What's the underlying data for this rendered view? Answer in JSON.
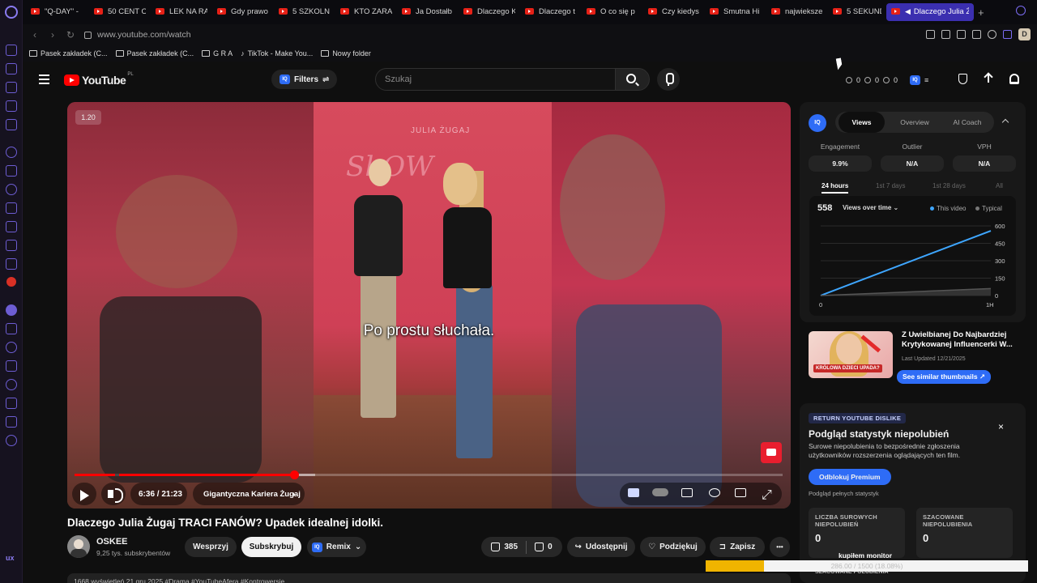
{
  "browser": {
    "tabs": [
      {
        "label": "\"Q-DAY\" - "
      },
      {
        "label": "50 CENT O"
      },
      {
        "label": "LEK NA RA"
      },
      {
        "label": "Gdy prawo"
      },
      {
        "label": "5 SZKOLN"
      },
      {
        "label": "KTO ZARA"
      },
      {
        "label": "Ja Dostałb"
      },
      {
        "label": "Dlaczego K"
      },
      {
        "label": "Dlaczego t"
      },
      {
        "label": "O co się p"
      },
      {
        "label": "Czy kiedys"
      },
      {
        "label": "Smutna Hi"
      },
      {
        "label": "najwieksze"
      },
      {
        "label": "5 SEKUND"
      },
      {
        "label": "Dlaczego Julia Ż"
      }
    ],
    "new_tab": "+",
    "url": "www.youtube.com/watch",
    "profile_initial": "D",
    "bookmarks": [
      {
        "label": "Pasek zakładek (C..."
      },
      {
        "label": "Pasek zakładek (C..."
      },
      {
        "label": "G R A"
      },
      {
        "label": "TikTok - Make You..."
      },
      {
        "label": "Nowy folder"
      }
    ]
  },
  "sidebar": {
    "bottom_label": "ux"
  },
  "header": {
    "logo": "YouTube",
    "region": "PL",
    "filters": "Filters",
    "iq_small": "IQ",
    "search_placeholder": "Szukaj",
    "stats": [
      "0",
      "0",
      "0"
    ]
  },
  "player": {
    "speed": "1.20",
    "subtitle": "Po prostu słuchała.",
    "wall_text": "JULIA ŻUGAJ",
    "wall_logo": "ShOW",
    "time": "6:36 / 21:23",
    "chapter": "Gigantyczna Kariera Żugaj",
    "chapter_arrow": "›",
    "progress": 0.31,
    "buffered": 0.34
  },
  "video": {
    "title": "Dlaczego Julia Żugaj TRACI FANÓW? Upadek idealnej idolki.",
    "channel": "OSKEE",
    "subscribers": "9,25 tys. subskrybentów",
    "buttons": {
      "support": "Wesprzyj",
      "subscribe": "Subskrybuj",
      "remix": "Remix",
      "likes": "385",
      "dislikes": "0",
      "share": "Udostępnij",
      "thanks": "Podziękuj",
      "save": "Zapisz",
      "more": "•••"
    },
    "description_peek": "1668 wyświetleń  21 gru 2025  #Drama #YouTubeAfera #Kontrowersje"
  },
  "vidiq": {
    "badge": "IQ",
    "tabs": [
      "Views",
      "Overview",
      "AI Coach"
    ],
    "active_tab": "Views",
    "metrics": [
      {
        "label": "Engagement",
        "value": "9.9%"
      },
      {
        "label": "Outlier",
        "value": "N/A"
      },
      {
        "label": "VPH",
        "value": "N/A"
      }
    ],
    "ranges": [
      "24 hours",
      "1st 7 days",
      "1st 28 days",
      "All"
    ],
    "active_range": "24 hours",
    "views": "558",
    "chart_selector": "Views over time ⌄",
    "legend_this": "This video",
    "legend_typical": "Typical",
    "colors": {
      "this_video": "#3ea6ff",
      "typical": "#555555"
    },
    "chart_data": {
      "type": "line",
      "x_ticks": [
        "0",
        "1H"
      ],
      "y_ticks": [
        "600",
        "450",
        "300",
        "150",
        "0"
      ],
      "ylim": [
        0,
        600
      ],
      "series": [
        {
          "name": "This video",
          "x": [
            0,
            1
          ],
          "values": [
            0,
            558
          ]
        },
        {
          "name": "Typical",
          "x": [
            0,
            1
          ],
          "values": [
            0,
            60
          ]
        }
      ]
    },
    "similar": {
      "title": "Z Uwielbianej Do Najbardziej Krytykowanej Influencerki W...",
      "date": "Last Updated 12/21/2025",
      "button": "See similar thumbnails ↗",
      "thumb_label": "KRÓLOWA DZIECI UPADA?"
    }
  },
  "ryd": {
    "badge": "RETURN YOUTUBE DISLIKE",
    "close": "×",
    "heading": "Podgląd statystyk niepolubień",
    "text": "Surowe niepolubienia to bezpośrednie zgłoszenia użytkowników rozszerzenia oglądających ten film.",
    "button": "Odblokuj Premium",
    "small": "Podgląd pełnych statystyk",
    "cards": [
      {
        "label": "LICZBA SUROWYCH NIEPOLUBIEŃ",
        "value": "0"
      },
      {
        "label": "SZACOWANE NIEPOLUBIENIA",
        "value": "0"
      }
    ],
    "more": "SZACOWANE POLUBIENIA"
  },
  "monitor": {
    "label": "kupiłem monitor",
    "text": "286.00 / 1500 (18.08%)",
    "progress": 0.1808
  }
}
